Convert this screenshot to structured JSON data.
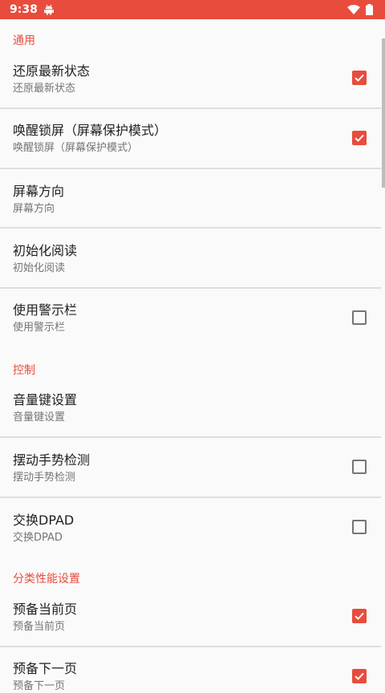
{
  "status_bar": {
    "time": "9:38",
    "icons": [
      "android-icon",
      "wifi-icon",
      "battery-icon"
    ]
  },
  "colors": {
    "accent": "#e84c3d",
    "title": "#212121",
    "summary": "#757575",
    "divider": "#dedede"
  },
  "sections": [
    {
      "header": "通用",
      "items": [
        {
          "title": "还原最新状态",
          "summary": "还原最新状态",
          "checkbox": true
        },
        {
          "title": "唤醒锁屏（屏幕保护模式）",
          "summary": "唤醒锁屏（屏幕保护模式）",
          "checkbox": true
        },
        {
          "title": "屏幕方向",
          "summary": "屏幕方向"
        },
        {
          "title": "初始化阅读",
          "summary": "初始化阅读"
        },
        {
          "title": "使用警示栏",
          "summary": "使用警示栏",
          "checkbox": false
        }
      ]
    },
    {
      "header": "控制",
      "items": [
        {
          "title": "音量键设置",
          "summary": "音量键设置"
        },
        {
          "title": "摆动手势检测",
          "summary": "摆动手势检测",
          "checkbox": false
        },
        {
          "title": "交换DPAD",
          "summary": "交换DPAD",
          "checkbox": false
        }
      ]
    },
    {
      "header": "分类性能设置",
      "items": [
        {
          "title": "预备当前页",
          "summary": "预备当前页",
          "checkbox": true
        },
        {
          "title": "预备下一页",
          "summary": "预备下一页",
          "checkbox": true
        }
      ]
    }
  ]
}
